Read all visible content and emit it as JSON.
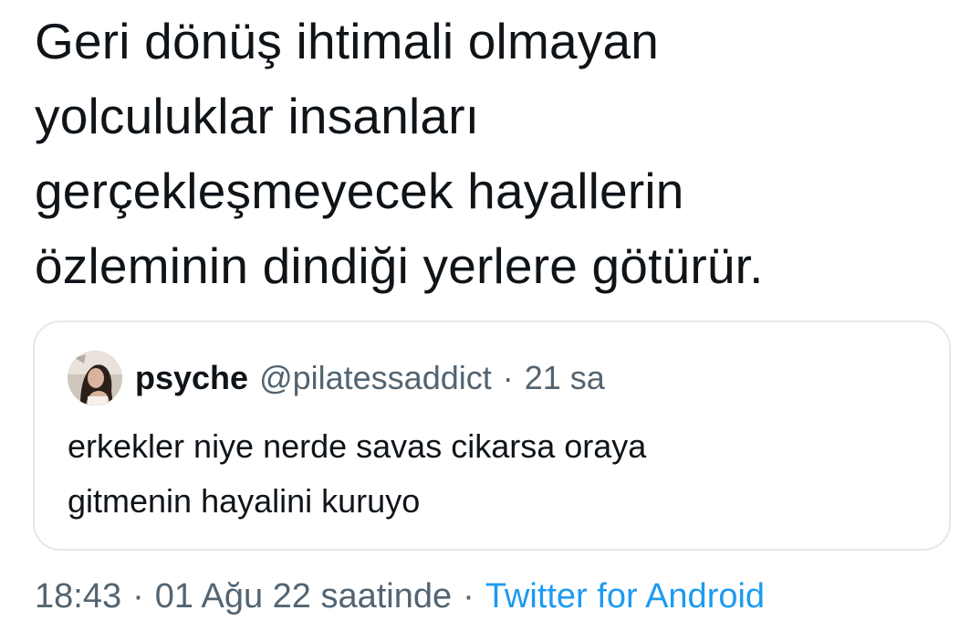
{
  "tweet": {
    "lines": [
      "Geri dönüş ihtimali olmayan",
      "yolculuklar insanları",
      "gerçekleşmeyecek hayallerin",
      "özleminin dindiği yerlere götürür."
    ]
  },
  "quoted_tweet": {
    "avatar_icon": "profile-photo",
    "display_name": "psyche",
    "handle": "@pilatessaddict",
    "separator": "·",
    "time_ago": "21 sa",
    "body_lines": [
      "erkekler niye nerde savas cikarsa oraya",
      "gitmenin hayalini kuruyo"
    ]
  },
  "meta": {
    "time": "18:43",
    "separator": "·",
    "date": "01 Ağu 22 saatinde",
    "source": "Twitter for Android"
  },
  "colors": {
    "text_primary": "#0f1419",
    "text_secondary": "#536471",
    "link": "#1d9bf0",
    "border": "#e4e8eb"
  }
}
